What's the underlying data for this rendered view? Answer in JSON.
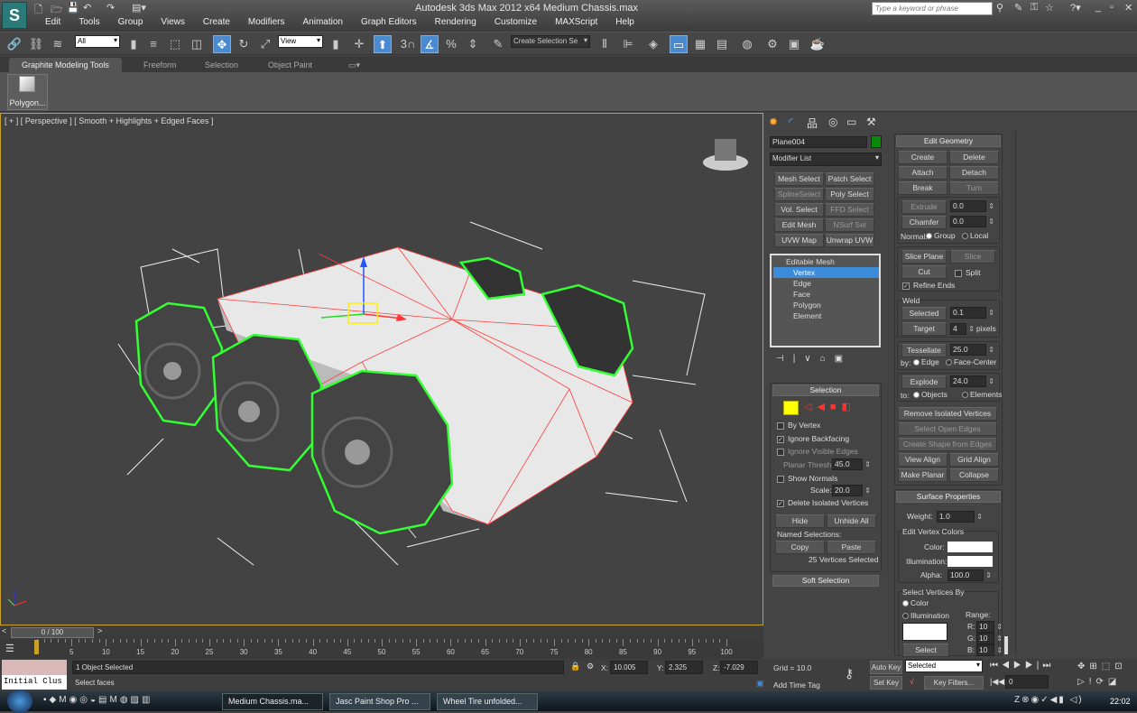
{
  "app": {
    "title": "Autodesk 3ds Max  2012 x64     Medium Chassis.max",
    "search_placeholder": "Type a keyword or phrase"
  },
  "menu": [
    "Edit",
    "Tools",
    "Group",
    "Views",
    "Create",
    "Modifiers",
    "Animation",
    "Graph Editors",
    "Rendering",
    "Customize",
    "MAXScript",
    "Help"
  ],
  "toolbar": {
    "selection_filter": "All",
    "reference_coord": "View",
    "named_selection": "Create Selection Se",
    "snap_label": "3"
  },
  "ribbon": {
    "tabs": [
      {
        "label": "Graphite Modeling Tools",
        "active": true
      },
      {
        "label": "Freeform"
      },
      {
        "label": "Selection"
      },
      {
        "label": "Object Paint"
      }
    ],
    "polygon_button": "Polygon..."
  },
  "viewport": {
    "label": "[ + ] [ Perspective ] [ Smooth + Highlights + Edged Faces ]",
    "selection_color": "#33ff33",
    "edge_color": "#ff3b3b"
  },
  "timeline": {
    "frame": "0 / 100",
    "ticks": [
      0,
      5,
      10,
      15,
      20,
      25,
      30,
      35,
      40,
      45,
      50,
      55,
      60,
      65,
      70,
      75,
      80,
      85,
      90,
      95,
      100
    ]
  },
  "status": {
    "maxscript_listener": "Initial Clus",
    "objects_selected": "1 Object Selected",
    "prompt": "Select faces",
    "x": "10.005",
    "y": "2.325",
    "z": "-7.029",
    "grid": "Grid = 10.0",
    "add_time_tag": "Add Time Tag",
    "auto_key": "Auto Key",
    "set_key": "Set Key",
    "key_mode": "Selected",
    "key_filters": "Key Filters...",
    "current_frame": "0"
  },
  "taskbar": {
    "tasks": [
      {
        "label": "Medium Chassis.ma...",
        "active": true
      },
      {
        "label": "Jasc Paint Shop Pro ..."
      },
      {
        "label": "Wheel Tire unfolded..."
      }
    ],
    "clock": "22:02"
  },
  "command_panel": {
    "object_name": "Plane004",
    "object_color": "#0a8a0a",
    "modifier_list": "Modifier List",
    "modifier_buttons": [
      {
        "label": "Mesh Select"
      },
      {
        "label": "Patch Select"
      },
      {
        "label": "SplineSelect",
        "disabled": true
      },
      {
        "label": "Poly Select"
      },
      {
        "label": "Vol. Select"
      },
      {
        "label": "FFD Select",
        "disabled": true
      },
      {
        "label": "Edit Mesh"
      },
      {
        "label": "NSurf Sel",
        "disabled": true
      },
      {
        "label": "UVW Map"
      },
      {
        "label": "Unwrap UVW"
      }
    ],
    "stack": [
      {
        "label": "Editable Mesh"
      },
      {
        "label": "Vertex",
        "active": true
      },
      {
        "label": "Edge"
      },
      {
        "label": "Face"
      },
      {
        "label": "Polygon"
      },
      {
        "label": "Element"
      }
    ],
    "selection": {
      "title": "Selection",
      "by_vertex": "By Vertex",
      "ignore_backfacing": "Ignore Backfacing",
      "ignore_visible_edges": "Ignore Visible Edges",
      "planar_thresh_label": "Planar Thresh:",
      "planar_thresh": "45.0",
      "show_normals": "Show Normals",
      "scale_label": "Scale:",
      "scale": "20.0",
      "delete_isolated": "Delete Isolated Vertices",
      "hide": "Hide",
      "unhide_all": "Unhide All",
      "named_selections": "Named Selections:",
      "copy": "Copy",
      "paste": "Paste",
      "count": "25 Vertices Selected"
    },
    "soft_selection": "Soft Selection",
    "edit_geometry": {
      "title": "Edit Geometry",
      "create": "Create",
      "delete": "Delete",
      "attach": "Attach",
      "detach": "Detach",
      "break": "Break",
      "turn": "Turn",
      "extrude": "Extrude",
      "extrude_val": "0.0",
      "chamfer": "Chamfer",
      "chamfer_val": "0.0",
      "normal": "Normal:",
      "group": "Group",
      "local": "Local",
      "slice_plane": "Slice Plane",
      "slice": "Slice",
      "cut": "Cut",
      "split": "Split",
      "refine_ends": "Refine Ends",
      "weld": "Weld",
      "selected": "Selected",
      "selected_val": "0.1",
      "target": "Target",
      "target_val": "4",
      "pixels": "pixels",
      "tessellate": "Tessellate",
      "tess_val": "25.0",
      "by": "by:",
      "edge": "Edge",
      "face_center": "Face-Center",
      "explode": "Explode",
      "explode_val": "24.0",
      "to": "to:",
      "objects": "Objects",
      "elements": "Elements",
      "remove_isolated": "Remove Isolated Vertices",
      "select_open_edges": "Select Open Edges",
      "create_shape": "Create Shape from Edges",
      "view_align": "View Align",
      "grid_align": "Grid Align",
      "make_planar": "Make Planar",
      "collapse": "Collapse"
    },
    "surface_properties": {
      "title": "Surface Properties",
      "weight_label": "Weight:",
      "weight": "1.0",
      "edit_vertex_colors": "Edit Vertex Colors",
      "color": "Color:",
      "illumination": "Illumination:",
      "alpha_label": "Alpha:",
      "alpha": "100.0",
      "select_by": "Select Vertices By",
      "by_color": "Color",
      "by_illum": "Illumination",
      "range": "Range:",
      "r": "10",
      "g": "10",
      "b": "10",
      "select": "Select"
    }
  }
}
